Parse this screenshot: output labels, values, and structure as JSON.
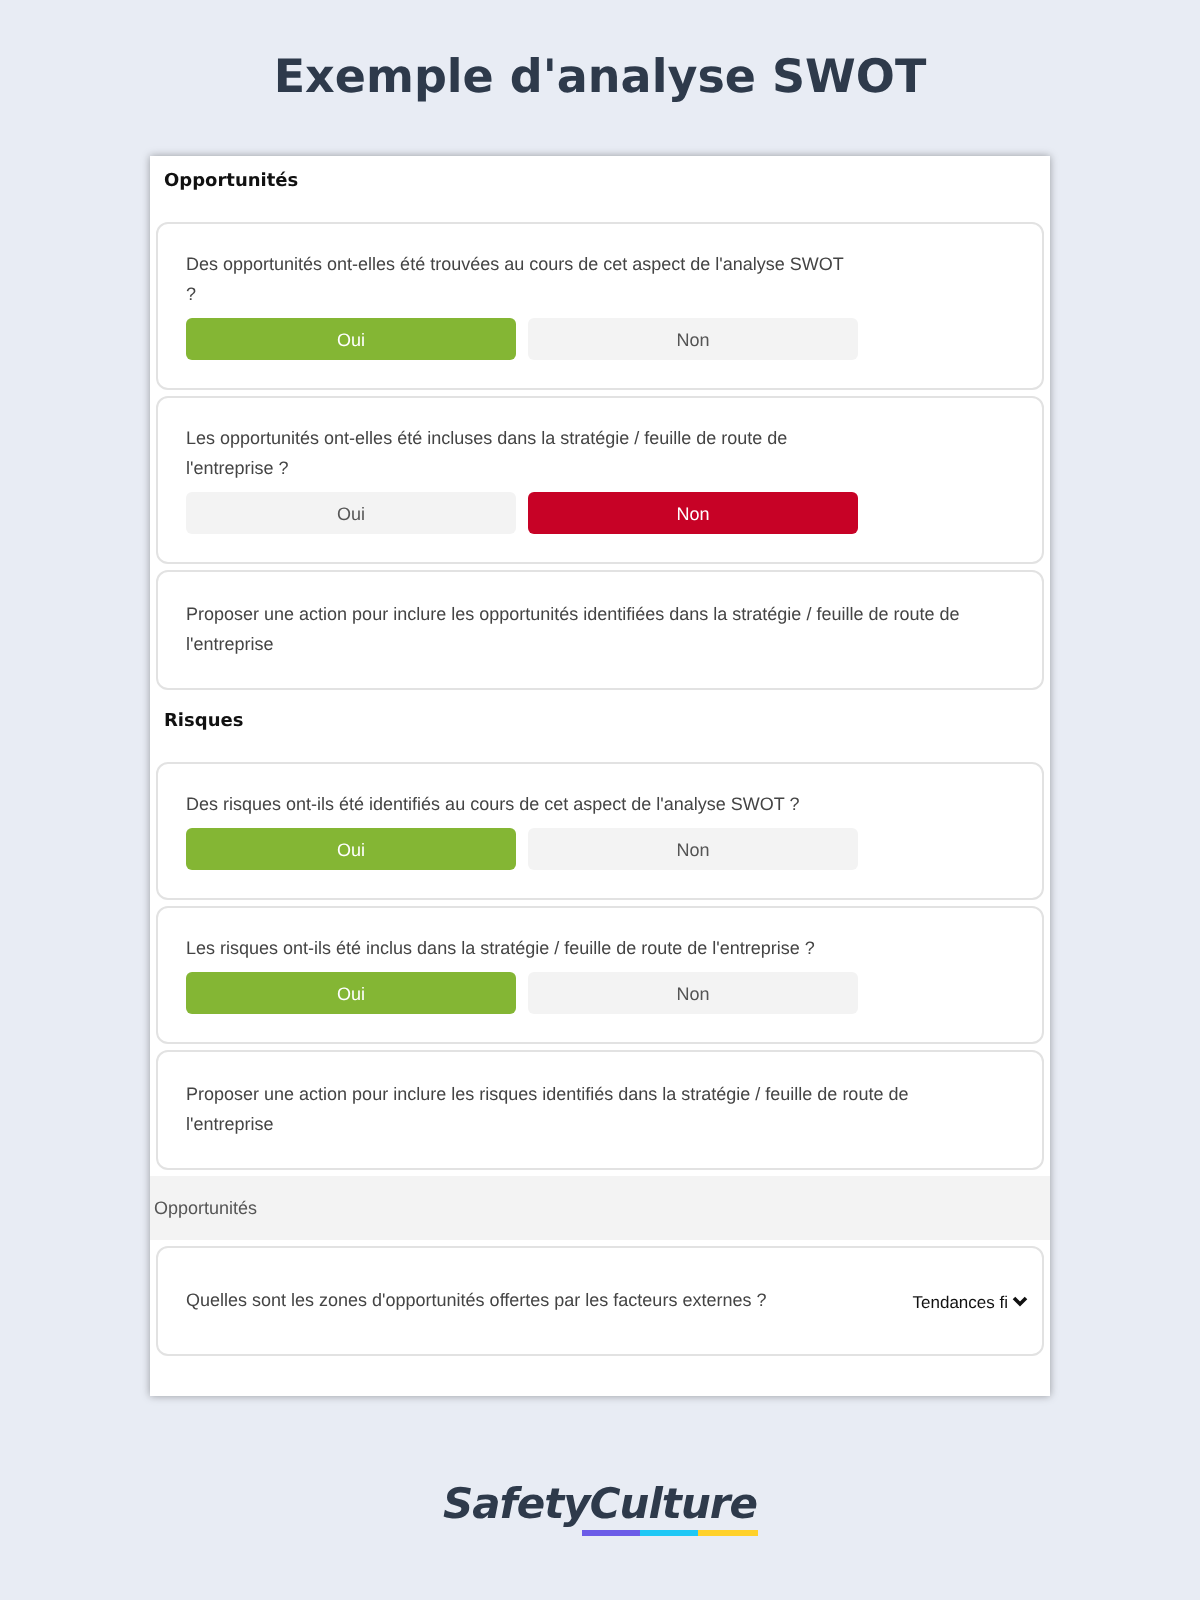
{
  "title": "Exemple d'analyse SWOT",
  "sections": [
    {
      "kind": "heading",
      "text": "Opportunités"
    },
    {
      "kind": "question",
      "text": "Des opportunités ont-elles été trouvées au cours de cet aspect de l'analyse SWOT ?",
      "options": [
        {
          "label": "Oui",
          "kind": "positive",
          "selected": true
        },
        {
          "label": "Non",
          "kind": "negative",
          "selected": false
        }
      ]
    },
    {
      "kind": "question",
      "text": "Les opportunités ont-elles été incluses dans la stratégie / feuille de route de l'entreprise ?",
      "options": [
        {
          "label": "Oui",
          "kind": "positive",
          "selected": false
        },
        {
          "label": "Non",
          "kind": "negative",
          "selected": true
        }
      ]
    },
    {
      "kind": "prompt",
      "text": "Proposer une action pour inclure les opportunités identifiées dans la stratégie / feuille de route de l'entreprise"
    },
    {
      "kind": "heading",
      "text": "Risques"
    },
    {
      "kind": "question",
      "text": "Des risques ont-ils été identifiés au cours de cet aspect de l'analyse SWOT ?",
      "options": [
        {
          "label": "Oui",
          "kind": "positive",
          "selected": true
        },
        {
          "label": "Non",
          "kind": "negative",
          "selected": false
        }
      ]
    },
    {
      "kind": "question",
      "text": "Les risques ont-ils été inclus dans la stratégie / feuille de route de l'entreprise ?",
      "options": [
        {
          "label": "Oui",
          "kind": "positive",
          "selected": true
        },
        {
          "label": "Non",
          "kind": "negative",
          "selected": false
        }
      ]
    },
    {
      "kind": "prompt",
      "text": "Proposer une action pour inclure les risques identifiés dans la stratégie / feuille de route de l'entreprise"
    },
    {
      "kind": "band",
      "text": "Opportunités"
    },
    {
      "kind": "select",
      "text": "Quelles sont les zones d'opportunités offertes par les facteurs externes ?",
      "value": "Tendances fi"
    }
  ],
  "brand": {
    "first": "Safety",
    "second": "Culture"
  }
}
